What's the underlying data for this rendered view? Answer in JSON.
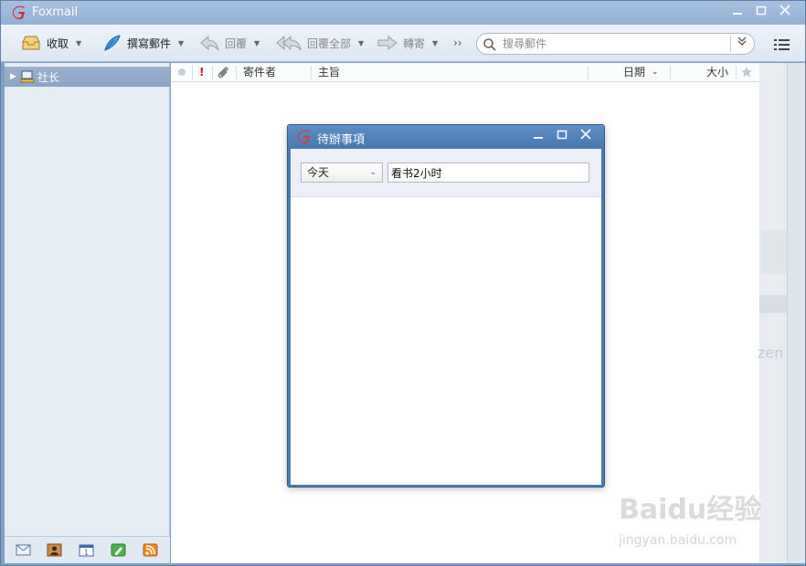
{
  "app": {
    "title": "Foxmail",
    "brand_color": "#d12a24"
  },
  "toolbar": {
    "receive_label": "收取",
    "compose_label": "撰寫郵件",
    "reply_label": "回覆",
    "reply_all_label": "回覆全部",
    "forward_label": "轉寄",
    "more_label": "››",
    "search_placeholder": "搜尋郵件"
  },
  "sidebar": {
    "account_label": "社长"
  },
  "mail_list": {
    "columns": {
      "sender": "寄件者",
      "subject": "主旨",
      "date": "日期",
      "size": "大小",
      "flag": "!"
    }
  },
  "background": {
    "brand_fragment": "zen"
  },
  "watermark": {
    "text": "Baidu经验",
    "url": "jingyan.baidu.com"
  },
  "todo_dialog": {
    "title": "待辦事項",
    "date_option": "今天",
    "task_value": "看书2小时"
  }
}
